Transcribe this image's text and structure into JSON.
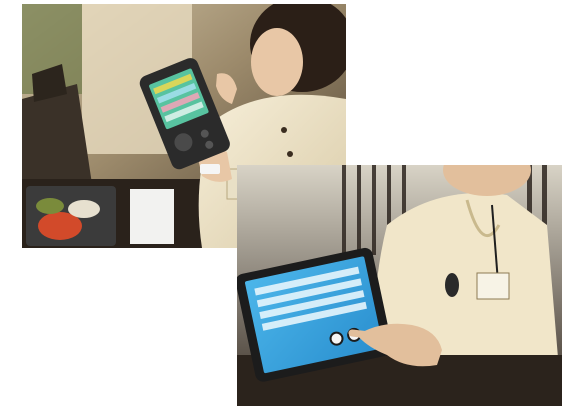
{
  "photos": [
    {
      "subject": "staff-using-handheld-terminal",
      "icon": "photo-icon"
    },
    {
      "subject": "staff-using-tablet",
      "icon": "photo-icon"
    }
  ],
  "colors": {
    "background": "#ffffff",
    "uniform": "#f1e6c9",
    "tablet_screen": "#3aa7e0",
    "handheld_screen": "#58c3a0"
  }
}
